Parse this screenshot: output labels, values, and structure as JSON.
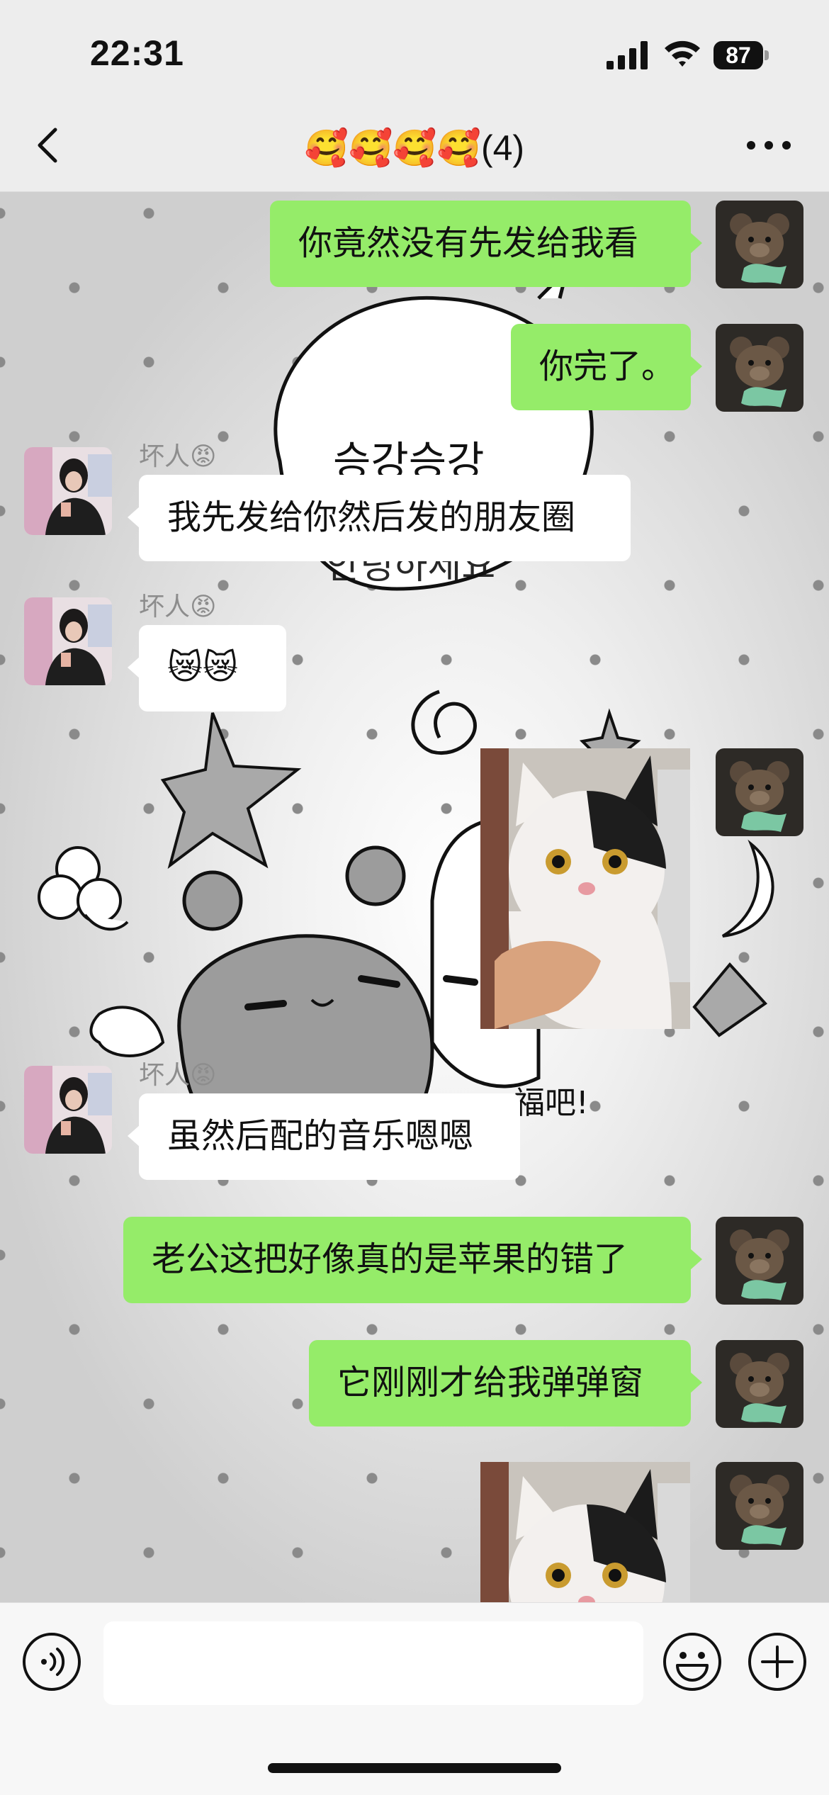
{
  "status": {
    "time": "22:31",
    "battery": "87"
  },
  "nav": {
    "title": "🥰🥰🥰🥰(4)",
    "back_icon": "chevron-left-icon",
    "more_icon": "more-dots-icon"
  },
  "messages": [
    {
      "from": "me",
      "type": "text",
      "text": "你竟然没有先发给我看"
    },
    {
      "from": "me",
      "type": "text",
      "text": "你完了。"
    },
    {
      "from": "other",
      "nickname": "坏人😡",
      "type": "text",
      "text": "我先发给你然后发的朋友圈"
    },
    {
      "from": "other",
      "nickname": "坏人😡",
      "type": "text",
      "text": "😿😿"
    },
    {
      "from": "me",
      "type": "image",
      "image": "cat-photo"
    },
    {
      "from": "other",
      "nickname": "坏人😡",
      "type": "text",
      "text": "虽然后配的音乐嗯嗯"
    },
    {
      "from": "me",
      "type": "text",
      "text": "老公这把好像真的是苹果的错了"
    },
    {
      "from": "me",
      "type": "text",
      "text": "它刚刚才给我弹弹窗"
    },
    {
      "from": "me",
      "type": "image",
      "image": "cat-photo"
    }
  ],
  "wallpaper": {
    "texts": [
      "승강승강",
      "안녕하세요",
      "福吧!"
    ]
  },
  "input_bar": {
    "voice_icon": "voice-icon",
    "emoji_icon": "emoji-icon",
    "plus_icon": "plus-icon",
    "text": ""
  },
  "colors": {
    "my_bubble": "#95ec69",
    "other_bubble": "#ffffff",
    "bar_bg": "#ededed"
  }
}
